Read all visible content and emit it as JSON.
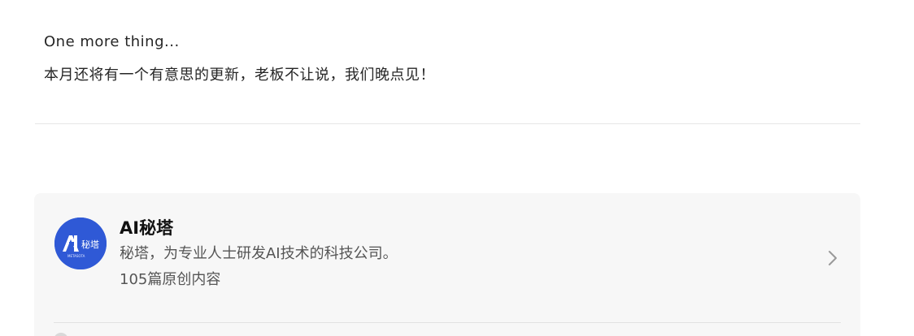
{
  "article": {
    "line1": "One more thing...",
    "line2": "本月还将有一个有意思的更新，老板不让说，我们晚点见！"
  },
  "account_card": {
    "avatar": {
      "logo_text": "秘塔",
      "logo_subtext": "METASOTA",
      "brand_color": "#2f59d6"
    },
    "name": "AI秘塔",
    "description": "秘塔，为专业人士研发AI技术的科技公司。",
    "article_count": "105篇原创内容",
    "chevron_icon": "chevron-right-icon"
  }
}
